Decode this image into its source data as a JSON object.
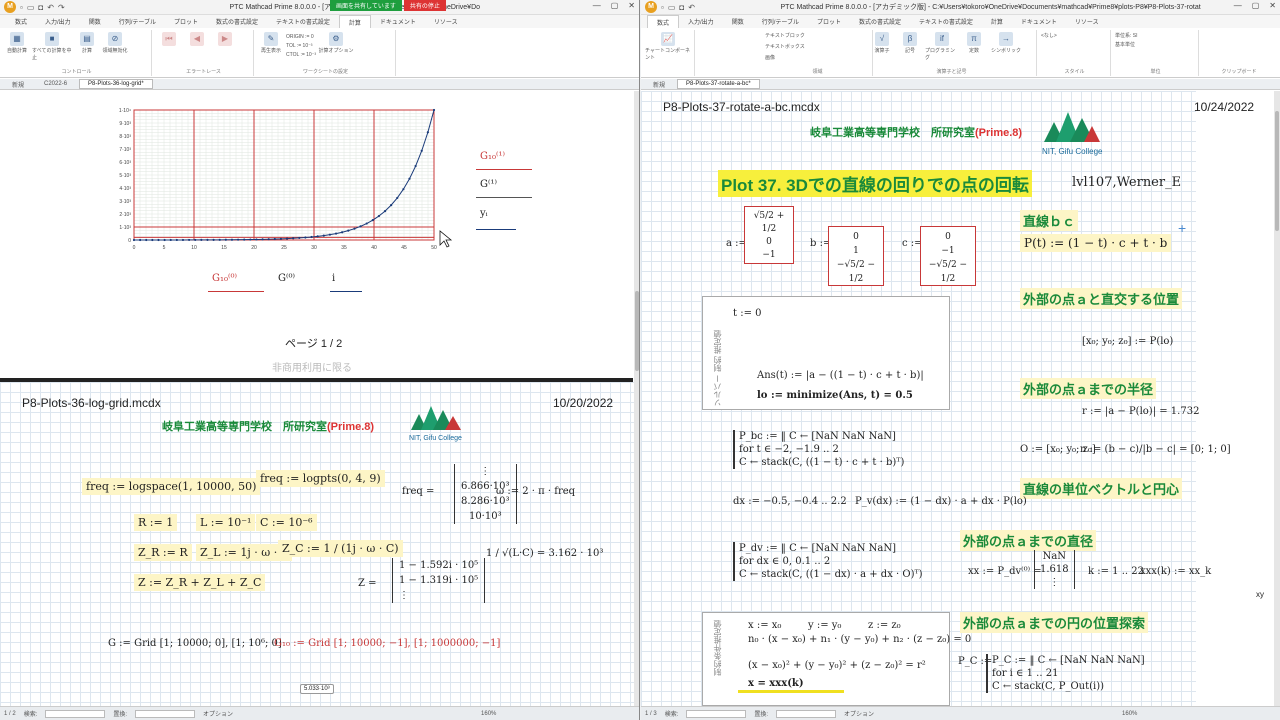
{
  "left": {
    "title": "PTC Mathcad Prime 8.0.0.0 - [アカデミック版] - C:¥Users¥tokoro¥OneDrive¥Documents¥mathcad¥Prime8¥plots-P8¥P8-Plots-36-log-grid.mcdx",
    "share": "画面を共有しています",
    "stop": "共有の停止",
    "tabs": [
      "数式",
      "入力/出力",
      "関数",
      "行列/テーブル",
      "プロット",
      "数式の書式設定",
      "テキストの書式設定",
      "計算",
      "ドキュメント",
      "リソース"
    ],
    "active_tab": "計算",
    "ribbon": {
      "b1": "自動計算",
      "b2": "すべての計算を中止",
      "b3": "計算",
      "b4": "領域無効化",
      "g1": "コントロール",
      "g2": "エラートレース",
      "b5": "再生表示",
      "g3": "ワークシートの設定",
      "origin": "ORIGIN := 0",
      "tol": "TOL := 10⁻³",
      "ctol": "CTOL := 10⁻³",
      "calcopt": "計算オプション"
    },
    "doctabs": [
      "新規",
      "C2022-6",
      "P8-Plots-36-log-grid*"
    ],
    "chart": {
      "ylabels": [
        "1·10⁴",
        "9·10³",
        "8·10³",
        "7·10³",
        "6·10³",
        "5·10³",
        "4·10³",
        "3·10³",
        "2·10³",
        "1·10³",
        "0"
      ],
      "xlabels": [
        "0",
        "5",
        "10",
        "15",
        "20",
        "25",
        "30",
        "35",
        "40",
        "45",
        "50"
      ],
      "legend_top": [
        "G₁₀⁽¹⁾",
        "G⁽¹⁾",
        "yᵢ"
      ],
      "legend_bottom": [
        "G₁₀⁽⁰⁾",
        "G⁽⁰⁾",
        "i"
      ]
    },
    "page_label": "ページ 1 / 2",
    "noncommercial": "非商用利用に限る",
    "doc2_name": "P8-Plots-36-log-grid.mcdx",
    "doc2_date": "10/20/2022",
    "school": "岐阜工業高等専門学校　所研究室",
    "prime": "(Prime.8)",
    "nit": "NIT, Gifu College",
    "m_freq": "freq := logspace(1, 10000, 50)",
    "m_logpts": "freq := logpts(0, 4, 9)",
    "m_freqeq": "freq =",
    "m_freqvals": [
      "⋮",
      "6.866·10³",
      "8.286·10³",
      "10·10³"
    ],
    "m_omega": "ω := 2 · π · freq",
    "m_R": "R := 1",
    "m_L": "L := 10⁻¹",
    "m_C": "C := 10⁻⁶",
    "m_ZR": "Z_R := R",
    "m_ZL": "Z_L := 1j · ω · L",
    "m_ZC": "Z_C := 1 / (1j · ω · C)",
    "m_Z": "Z := Z_R + Z_L + Z_C",
    "m_Zeq": "Z =",
    "m_Zvals": [
      "1 − 1.592i · 10⁵",
      "1 − 1.319i · 10⁵",
      "⋮"
    ],
    "m_res": "1 / √(L·C) = 3.162 · 10³",
    "m_G": "G := Grid",
    "m_Gargs": "[1; 10000; 0], [1; 10⁶; 0]",
    "m_G10": "G₁₀ := Grid",
    "m_G10args": "[1; 10000; −1], [1; 1000000; −1]",
    "tip": "5.033·10³",
    "status": {
      "page": "1 / 2",
      "find": "検索:",
      "replace": "置換:",
      "options": "オプション",
      "zoom": "160%"
    }
  },
  "right": {
    "title": "PTC Mathcad Prime 8.0.0.0 - [アカデミック版] - C:¥Users¥tokoro¥OneDrive¥Documents¥mathcad¥Prime8¥plots-P8¥P8-Plots-37-rotate-a-bc.mcdx",
    "tabs": [
      "数式",
      "入力/出力",
      "関数",
      "行列/テーブル",
      "プロット",
      "数式の書式設定",
      "テキストの書式設定",
      "計算",
      "ドキュメント",
      "リソース"
    ],
    "active_tab": "数式",
    "ribbon": {
      "r1": "テキストブロック",
      "r2": "テキストボックス",
      "r3": "画像",
      "g1": "領域",
      "o1": "演算子",
      "o2": "記号",
      "o3": "プログラミング",
      "o4": "定数",
      "o5": "シンボリック",
      "g2": "演算子と記号",
      "g3": "スタイル",
      "g4": "単位",
      "g5": "クリップボード",
      "chart": "チャートコンポーネント",
      "style": "<なし>",
      "unitsys": "単位系: SI",
      "base": "基本単位"
    },
    "doctabs": [
      "新規",
      "P8-Plots-37-rotate-a-bc*"
    ],
    "doc_name": "P8-Plots-37-rotate-a-bc.mcdx",
    "doc_date": "10/24/2022",
    "school": "岐阜工業高等専門学校　所研究室",
    "prime": "(Prime.8)",
    "nit": "NIT, Gifu College",
    "plot_title": "Plot 37. 3Dでの直線の回りでの点の回転",
    "author": "lvl107,Werner_E",
    "a_def": "a :=",
    "a_vals": [
      "√5/2 + 1/2",
      "0",
      "−1"
    ],
    "b_def": "b :=",
    "b_vals": [
      "0",
      "1",
      "−√5/2 − 1/2"
    ],
    "c_def": "c :=",
    "c_vals": [
      "0",
      "−1",
      "−√5/2 − 1/2"
    ],
    "n1": "直線ｂｃ",
    "Pt": "P(t) := (1 − t) · c + t · b",
    "n2": "外部の点ａと直交する位置",
    "solver": "ソルバー 制約 推定値",
    "t0": "t := 0",
    "xyz": "[x₀; y₀; z₀] := P(lo)",
    "ans": "Ans(t) := |a − ((1 − t) · c + t · b)|",
    "lo": "lo := minimize(Ans, t) = 0.5",
    "n3": "外部の点ａまでの半径",
    "r": "r := |a − P(lo)| = 1.732",
    "Pbc": "P_bc := ‖ C ← [NaN NaN NaN]",
    "Pbc2": "for t ∈ −2, −1.9 .. 2",
    "Pbc3": "C ← stack(C, ((1 − t) · c + t · b)ᵀ)",
    "O": "O := [x₀; y₀; z₀]",
    "n": "n := (b − c)/|b − c| = [0; 1; 0]",
    "n4": "直線の単位ベクトルと円心",
    "dx": "dx := −0.5, −0.4 .. 2.2",
    "Pv": "P_v(dx) := (1 − dx) · a + dx · P(lo)",
    "n5": "外部の点ａまでの直径",
    "Pdv": "P_dv := ‖ C ← [NaN NaN NaN]",
    "Pdv2": "for dx ∈ 0, 0.1 .. 2",
    "Pdv3": "C ← stack(C, ((1 − dx) · a + dx · O)ᵀ)",
    "xx": "xx := P_dv⁽⁰⁾ =",
    "xxv": [
      "NaN",
      "1.618",
      "⋮"
    ],
    "k": "k := 1 .. 22",
    "xxx": "xxx(k) := xx_k",
    "n6": "外部の点ａまでの円の位置探索",
    "constraint": "制約条件推定値",
    "x1": "x := x₀",
    "y1": "y := y₀",
    "z1": "z := z₀",
    "eq1": "n₀ · (x − x₀) + n₁ · (y − y₀) + n₂ · (z − z₀) = 0",
    "eq2": "(x − x₀)² + (y − y₀)² + (z − z₀)² = r²",
    "eq3": "x = xxx(k)",
    "PC": "P_C := ‖ C ← [NaN NaN NaN]",
    "PC2": "for i ∈ 1 .. 21",
    "PC3": "C ← stack(C, P_Out(i))",
    "xy": "xy",
    "status": {
      "page": "1 / 3",
      "find": "検索:",
      "replace": "置換:",
      "options": "オプション",
      "zoom": "160%"
    }
  }
}
